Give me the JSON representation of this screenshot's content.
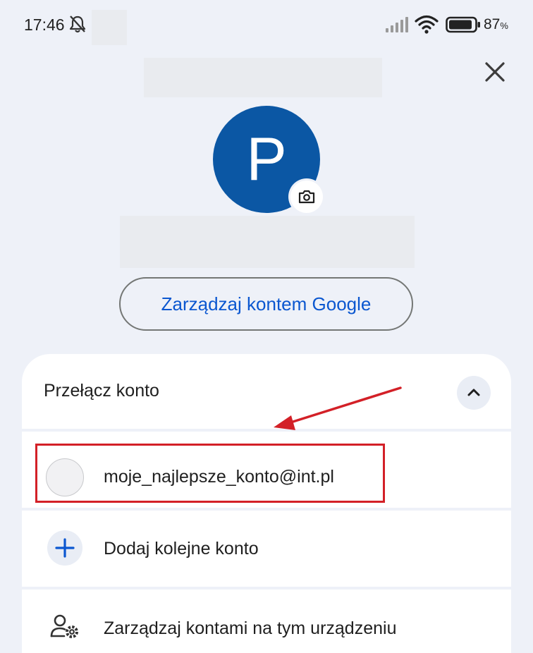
{
  "status_bar": {
    "time": "17:46",
    "battery_percent": "87",
    "battery_unit": "%",
    "icons": [
      "bell-off-icon",
      "signal-icon",
      "wifi-icon",
      "battery-icon"
    ]
  },
  "header": {
    "close_icon": "close-icon",
    "avatar_letter": "P",
    "avatar_color": "#0b57a4",
    "camera_icon": "camera-icon",
    "manage_google_account": "Zarządzaj kontem Google"
  },
  "account_panel": {
    "title": "Przełącz konto",
    "collapse_icon": "chevron-up-icon",
    "accounts": [
      {
        "email": "moje_najlepsze_konto@int.pl"
      }
    ],
    "add_account": "Dodaj kolejne konto",
    "manage_accounts": "Zarządzaj kontami na tym urządzeniu"
  },
  "annotations": {
    "highlight_color": "#d32027",
    "arrow_color": "#d32027"
  }
}
